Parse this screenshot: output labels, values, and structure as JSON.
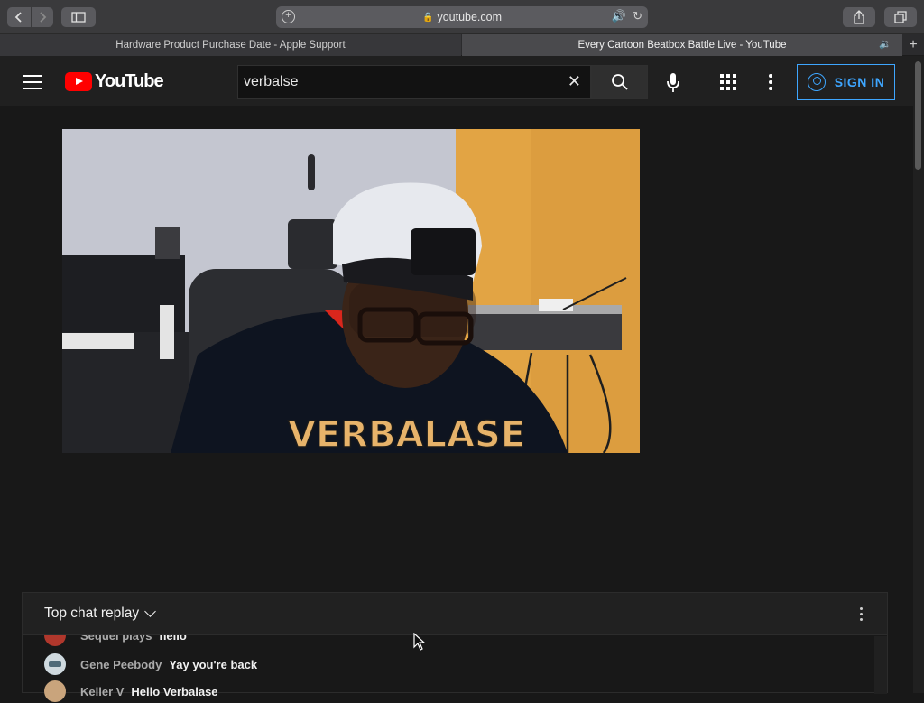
{
  "browser": {
    "address": "youtube.com",
    "tabs": [
      {
        "title": "Hardware Product Purchase Date - Apple Support",
        "active": false
      },
      {
        "title": "Every Cartoon Beatbox Battle Live - YouTube",
        "active": true
      }
    ]
  },
  "youtube": {
    "logo_text": "YouTube",
    "search_value": "verbalse",
    "sign_in_label": "SIGN IN"
  },
  "video": {
    "shirt_text": "VERBALASE"
  },
  "chat": {
    "title": "Top chat replay",
    "messages": [
      {
        "author": "Sequel plays",
        "text": "hello",
        "avatar_color": "#b0372c"
      },
      {
        "author": "Gene Peebody",
        "text": "Yay you're back",
        "avatar_color": "#8fa7b3"
      },
      {
        "author": "Keller V",
        "text": "Hello Verbalase",
        "avatar_color": "#c9a47c"
      }
    ]
  },
  "colors": {
    "brand_red": "#ff0000",
    "accent_blue": "#3ea6ff",
    "background": "#181818"
  }
}
